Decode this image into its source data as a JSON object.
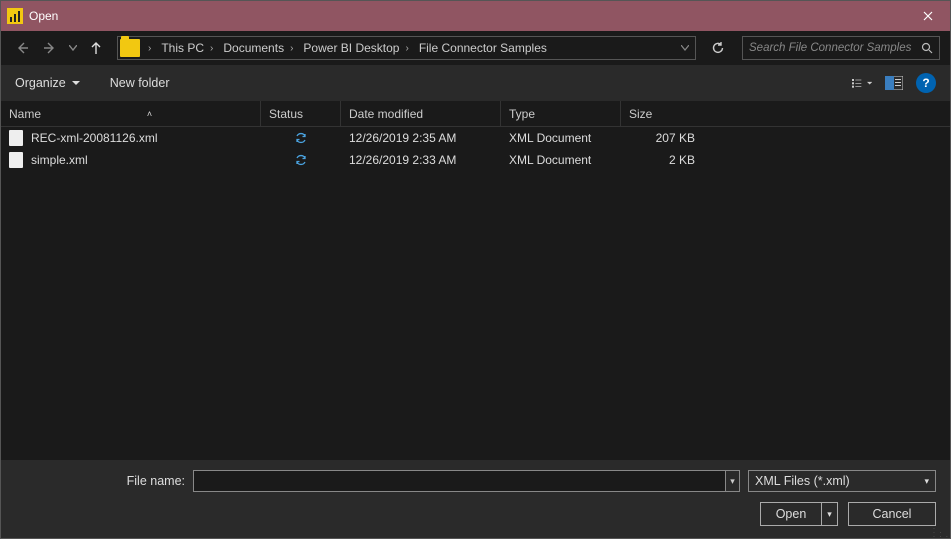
{
  "title": "Open",
  "breadcrumb": [
    "This PC",
    "Documents",
    "Power BI Desktop",
    "File Connector Samples"
  ],
  "search_placeholder": "Search File Connector Samples",
  "toolbar": {
    "organize": "Organize",
    "new_folder": "New folder"
  },
  "columns": {
    "name": "Name",
    "status": "Status",
    "date": "Date modified",
    "type": "Type",
    "size": "Size"
  },
  "sort_column": "name",
  "files": [
    {
      "name": "REC-xml-20081126.xml",
      "status": "sync",
      "date": "12/26/2019 2:35 AM",
      "type": "XML Document",
      "size": "207 KB"
    },
    {
      "name": "simple.xml",
      "status": "sync",
      "date": "12/26/2019 2:33 AM",
      "type": "XML Document",
      "size": "2 KB"
    }
  ],
  "file_name_label": "File name:",
  "file_name_value": "",
  "filter_selected": "XML Files (*.xml)",
  "buttons": {
    "open": "Open",
    "cancel": "Cancel"
  }
}
